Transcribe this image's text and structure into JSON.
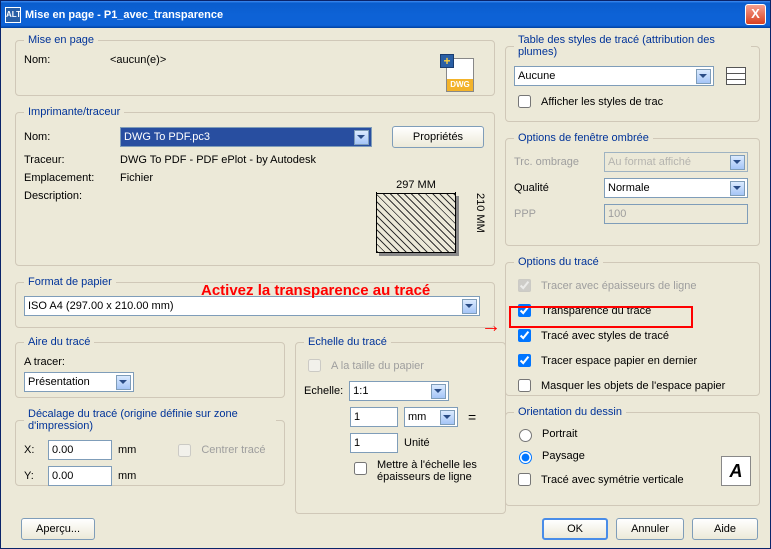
{
  "titlebar": {
    "title": "Mise en page - P1_avec_transparence",
    "close": "X",
    "appIcon": "ALT"
  },
  "miseEnPage": {
    "legend": "Mise en page",
    "nomLabel": "Nom:",
    "nomValue": "<aucun(e)>",
    "dwgBadge": "DWG"
  },
  "imprimante": {
    "legend": "Imprimante/traceur",
    "nomLabel": "Nom:",
    "nomValue": "DWG To PDF.pc3",
    "proprietesBtn": "Propriétés",
    "traceurLabel": "Traceur:",
    "traceurValue": "DWG To PDF - PDF ePlot - by Autodesk",
    "emplacementLabel": "Emplacement:",
    "emplacementValue": "Fichier",
    "descriptionLabel": "Description:",
    "paperWidth": "297 MM",
    "paperHeight": "210 MM"
  },
  "formatPapier": {
    "legend": "Format de papier",
    "value": "ISO A4 (297.00 x 210.00 mm)"
  },
  "aireTrace": {
    "legend": "Aire du tracé",
    "aTracerLabel": "A tracer:",
    "value": "Présentation"
  },
  "decalage": {
    "legend": "Décalage du tracé (origine définie sur zone d'impression)",
    "xLabel": "X:",
    "xValue": "0.00",
    "xUnit": "mm",
    "yLabel": "Y:",
    "yValue": "0.00",
    "yUnit": "mm",
    "centrerLabel": "Centrer tracé"
  },
  "echelle": {
    "legend": "Echelle du tracé",
    "tailleLabel": "A la taille du papier",
    "echelleLabel": "Echelle:",
    "echelleValue": "1:1",
    "val1": "1",
    "unit1": "mm",
    "equals": "=",
    "val2": "1",
    "unit2": "Unité",
    "mettreLabel": "Mettre à l'échelle les épaisseurs de ligne"
  },
  "tableStyles": {
    "legend": "Table des styles de tracé (attribution des plumes)",
    "value": "Aucune",
    "afficherLabel": "Afficher les styles de trac"
  },
  "fenetreOmbree": {
    "legend": "Options de fenêtre ombrée",
    "trcLabel": "Trc. ombrage",
    "trcValue": "Au format affiché",
    "qualiteLabel": "Qualité",
    "qualiteValue": "Normale",
    "pppLabel": "PPP",
    "pppValue": "100"
  },
  "optionsTrace": {
    "legend": "Options du tracé",
    "chk1": "Tracer avec épaisseurs de ligne",
    "chk2": "Transparence du tracé",
    "chk3": "Tracé avec styles de tracé",
    "chk4": "Tracer espace papier en dernier",
    "chk5": "Masquer les objets de l'espace papier"
  },
  "orientation": {
    "legend": "Orientation du dessin",
    "portrait": "Portrait",
    "paysage": "Paysage",
    "symetrie": "Tracé avec symétrie verticale",
    "iconLetter": "A"
  },
  "footer": {
    "apercu": "Aperçu...",
    "ok": "OK",
    "annuler": "Annuler",
    "aide": "Aide"
  },
  "annotation": {
    "text": "Activez la transparence au tracé"
  }
}
